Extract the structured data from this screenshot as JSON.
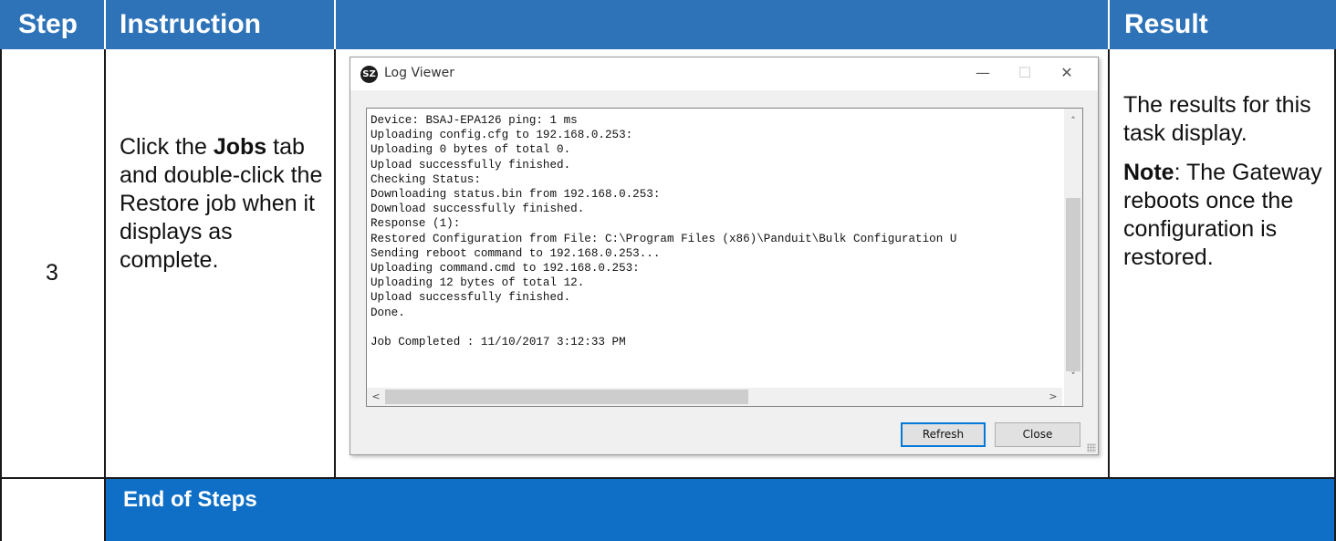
{
  "table": {
    "headers": {
      "step": "Step",
      "instruction": "Instruction",
      "result": "Result"
    },
    "row": {
      "step_number": "3",
      "instruction": {
        "pre": "Click the ",
        "bold": "Jobs",
        "post": " tab and double-click the Restore job when it displays as complete."
      },
      "result": {
        "line1": "The results for this task display.",
        "note_label": "Note",
        "note_text": ": The Gateway reboots once the configuration is restored."
      }
    },
    "end_row": "End of Steps"
  },
  "log_viewer": {
    "title": "Log Viewer",
    "icon": "sz-logo-icon",
    "controls": {
      "minimize": "—",
      "maximize": "☐",
      "close": "✕"
    },
    "log_lines": [
      "Device: BSAJ-EPA126 ping: 1 ms",
      "Uploading config.cfg to 192.168.0.253:",
      "Uploading 0 bytes of total 0.",
      "Upload successfully finished.",
      "Checking Status:",
      "Downloading status.bin from 192.168.0.253:",
      "Download successfully finished.",
      "Response (1):",
      "Restored Configuration from File: C:\\Program Files (x86)\\Panduit\\Bulk Configuration U",
      "Sending reboot command to 192.168.0.253...",
      "Uploading command.cmd to 192.168.0.253:",
      "Uploading 12 bytes of total 12.",
      "Upload successfully finished.",
      "Done.",
      "",
      "Job Completed : 11/10/2017 3:12:33 PM"
    ],
    "buttons": {
      "refresh": "Refresh",
      "close": "Close"
    }
  },
  "colors": {
    "header_blue": "#2e73b8",
    "end_row_blue": "#0f6fc6"
  }
}
